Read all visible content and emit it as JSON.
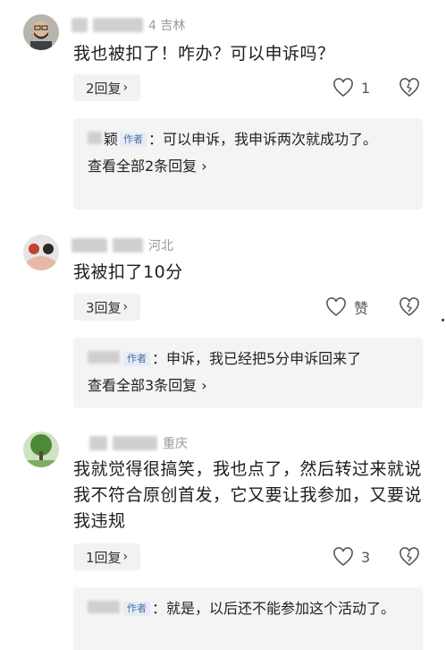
{
  "comments": [
    {
      "location": "4  吉林",
      "text": "我也被扣了！咋办？可以申诉吗？",
      "reply_count": "2回复",
      "like_label": "1",
      "sub_reply": {
        "name_tail": "颖",
        "author_tag": "作者",
        "text": "：可以申诉，我申诉两次就成功了。"
      },
      "view_all": "查看全部2条回复"
    },
    {
      "location": "河北",
      "text": "我被扣了10分",
      "reply_count": "3回复",
      "like_label": "赞",
      "sub_reply": {
        "name_tail": "",
        "author_tag": "作者",
        "text": "：申诉，我已经把5分申诉回来了"
      },
      "view_all": "查看全部3条回复"
    },
    {
      "location": "重庆",
      "text": "我就觉得很搞笑，我也点了，然后转过来就说我不符合原创首发，它又要让我参加，又要说我违规",
      "reply_count": "1回复",
      "like_label": "3",
      "sub_reply": {
        "name_tail": "",
        "author_tag": "作者",
        "text": "：就是，以后还不能参加这个活动了。"
      },
      "view_all": ""
    }
  ],
  "icons": {
    "like": "heart-outline-icon",
    "dislike": "broken-heart-icon",
    "chevron": "chevron-right-icon"
  },
  "colors": {
    "author_tag": "#4a6da8",
    "reply_bg": "#f4f4f4",
    "location": "#9a9a9a"
  }
}
